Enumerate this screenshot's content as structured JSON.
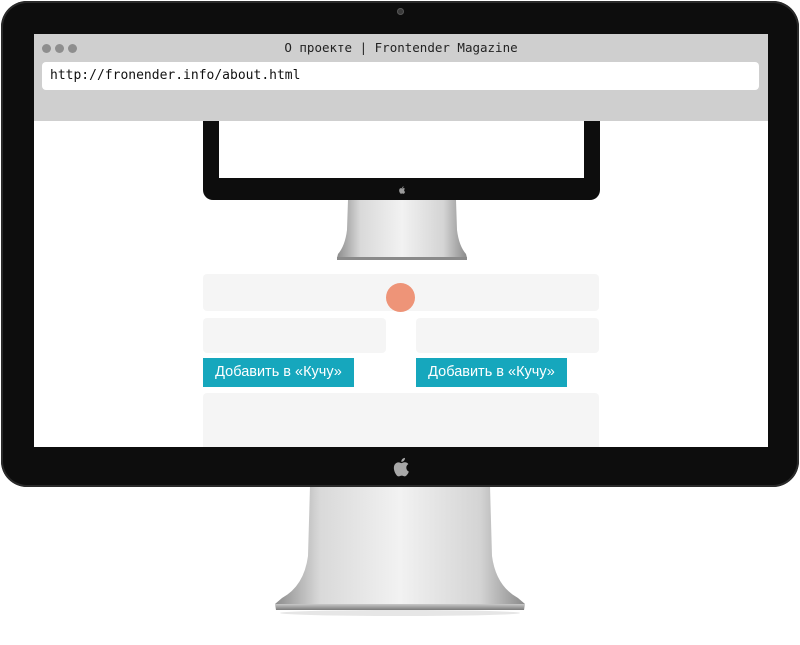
{
  "browser": {
    "title": "О проекте | Frontender Magazine",
    "url": "http://fronender.info/about.html"
  },
  "page": {
    "buttons": [
      {
        "label": "Добавить в «Кучу»"
      },
      {
        "label": "Добавить в «Кучу»"
      }
    ]
  },
  "icons": {
    "logo": "apple-logo-icon",
    "window_controls": [
      "window-dot-icon",
      "window-dot-icon",
      "window-dot-icon"
    ]
  },
  "colors": {
    "button": "#16a7bd",
    "accent_circle": "#ee9478",
    "placeholder_block": "#f5f5f5",
    "chrome": "#cfcfcf",
    "bezel": "#0d0d0d"
  }
}
